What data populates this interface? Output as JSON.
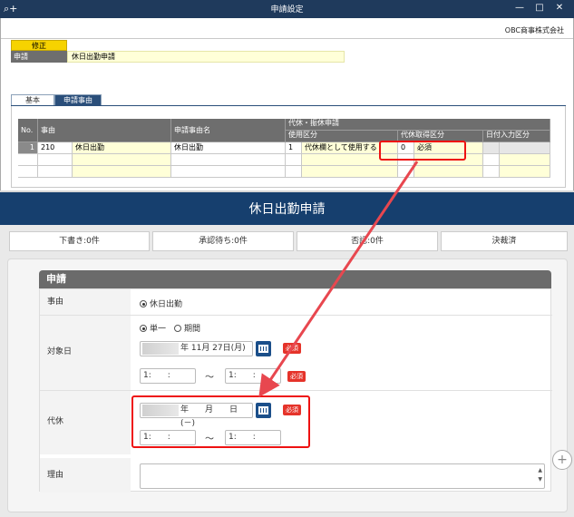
{
  "window": {
    "title": "申請設定",
    "search_glyph": "⌕+",
    "min_glyph": "—",
    "max_glyph": "□",
    "close_glyph": "✕",
    "company": "OBC商事株式会社"
  },
  "record": {
    "mode": "修正",
    "shinsei_label": "申請",
    "shinsei_value": "休日出勤申請"
  },
  "tabs": [
    "基本",
    "申請事由"
  ],
  "grid": {
    "headers": {
      "no": "No.",
      "jiyu": "事由",
      "jiyu_name": "申請事由名",
      "group": "代休・振休申請",
      "shiyo": "使用区分",
      "shutoku": "代休取得区分",
      "hizuke": "日付入力区分"
    },
    "row": {
      "no": "1",
      "code": "210",
      "jiyu": "休日出勤",
      "jiyu_name": "休日出勤",
      "shiyo_code": "1",
      "shiyo": "代休欄として使用する",
      "shutoku_code": "0",
      "shutoku": "必須"
    }
  },
  "app": {
    "title": "休日出勤申請",
    "stats": [
      "下書き:0件",
      "承認待ち:0件",
      "否認:0件",
      "決裁済"
    ],
    "section": "申請",
    "labels": {
      "jiyu": "事由",
      "target": "対象日",
      "daikyu": "代休",
      "reason": "理由"
    },
    "jiyu_value": "休日出勤",
    "radio_single": "単一",
    "radio_period": "期間",
    "target_date": "年 11月 27日(月)",
    "daikyu_date": "年　　月　　日(－)",
    "time_placeholder": "1:　　:",
    "tilde": "～",
    "required": "必須",
    "fab": "+"
  }
}
